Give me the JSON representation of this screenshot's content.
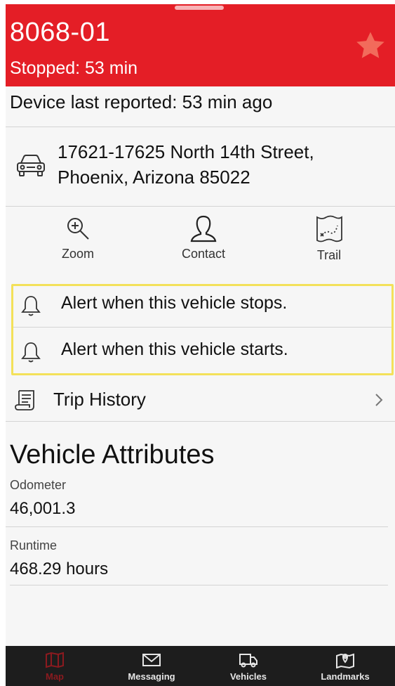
{
  "header": {
    "vehicle_name": "8068-01",
    "status": "Stopped: 53 min",
    "favorite_icon": "star-icon",
    "accent_color": "#e41e26"
  },
  "device": {
    "last_reported": "Device last reported: 53 min  ago"
  },
  "location": {
    "icon": "car-icon",
    "address_line1": "17621-17625 North 14th Street,",
    "address_line2": "Phoenix, Arizona 85022"
  },
  "actions": [
    {
      "label": "Zoom",
      "icon": "zoom-in-icon"
    },
    {
      "label": "Contact",
      "icon": "contact-person-icon"
    },
    {
      "label": "Trail",
      "icon": "trail-map-icon"
    }
  ],
  "alerts": [
    {
      "label": "Alert when this vehicle stops.",
      "icon": "bell-icon"
    },
    {
      "label": "Alert when this vehicle starts.",
      "icon": "bell-icon"
    }
  ],
  "trip_history": {
    "label": "Trip History",
    "icon": "trip-history-icon",
    "chevron": "chevron-right-icon"
  },
  "vehicle_attributes": {
    "title": "Vehicle Attributes",
    "odometer_label": "Odometer",
    "odometer_value": "46,001.3",
    "runtime_label": "Runtime",
    "runtime_value": "468.29 hours"
  },
  "tabbar": {
    "tabs": [
      {
        "label": "Map",
        "icon": "map-icon",
        "active": true
      },
      {
        "label": "Messaging",
        "icon": "envelope-icon",
        "active": false
      },
      {
        "label": "Vehicles",
        "icon": "truck-icon",
        "active": false
      },
      {
        "label": "Landmarks",
        "icon": "landmark-pin-icon",
        "active": false
      }
    ]
  }
}
